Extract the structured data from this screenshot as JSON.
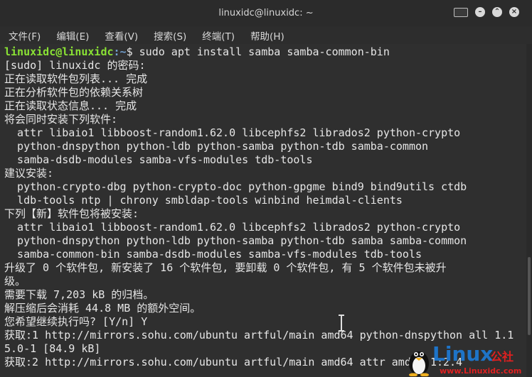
{
  "window": {
    "title": "linuxidc@linuxidc: ~"
  },
  "menu": [
    "文件(F)",
    "编辑(E)",
    "查看(V)",
    "搜索(S)",
    "终端(T)",
    "帮助(H)"
  ],
  "prompt": {
    "user_host": "linuxidc@linuxidc",
    "path": ":~",
    "command": "$ sudo apt install samba samba-common-bin"
  },
  "output_lines": [
    "[sudo] linuxidc 的密码:",
    "正在读取软件包列表... 完成",
    "正在分析软件包的依赖关系树",
    "正在读取状态信息... 完成",
    "将会同时安装下列软件:",
    "  attr libaio1 libboost-random1.62.0 libcephfs2 librados2 python-crypto",
    "  python-dnspython python-ldb python-samba python-tdb samba-common",
    "  samba-dsdb-modules samba-vfs-modules tdb-tools",
    "建议安装:",
    "  python-crypto-dbg python-crypto-doc python-gpgme bind9 bind9utils ctdb",
    "  ldb-tools ntp | chrony smbldap-tools winbind heimdal-clients",
    "下列【新】软件包将被安装:",
    "  attr libaio1 libboost-random1.62.0 libcephfs2 librados2 python-crypto",
    "  python-dnspython python-ldb python-samba python-tdb samba samba-common",
    "  samba-common-bin samba-dsdb-modules samba-vfs-modules tdb-tools",
    "升级了 0 个软件包, 新安装了 16 个软件包, 要卸载 0 个软件包, 有 5 个软件包未被升",
    "级。",
    "需要下载 7,203 kB 的归档。",
    "解压缩后会消耗 44.8 MB 的额外空间。",
    "您希望继续执行吗? [Y/n] Y",
    "获取:1 http://mirrors.sohu.com/ubuntu artful/main amd64 python-dnspython all 1.1",
    "5.0-1 [84.9 kB]",
    "获取:2 http://mirrors.sohu.com/ubuntu artful/main amd64 attr amd64 1:2.4"
  ],
  "watermark": {
    "brand": "Linux",
    "brand_cn": "公社",
    "url": "www.Linuxidc.com"
  },
  "icons": {
    "terminal": "terminal-icon",
    "minimize": "minimize-icon",
    "maximize": "maximize-icon",
    "close": "close-icon"
  }
}
